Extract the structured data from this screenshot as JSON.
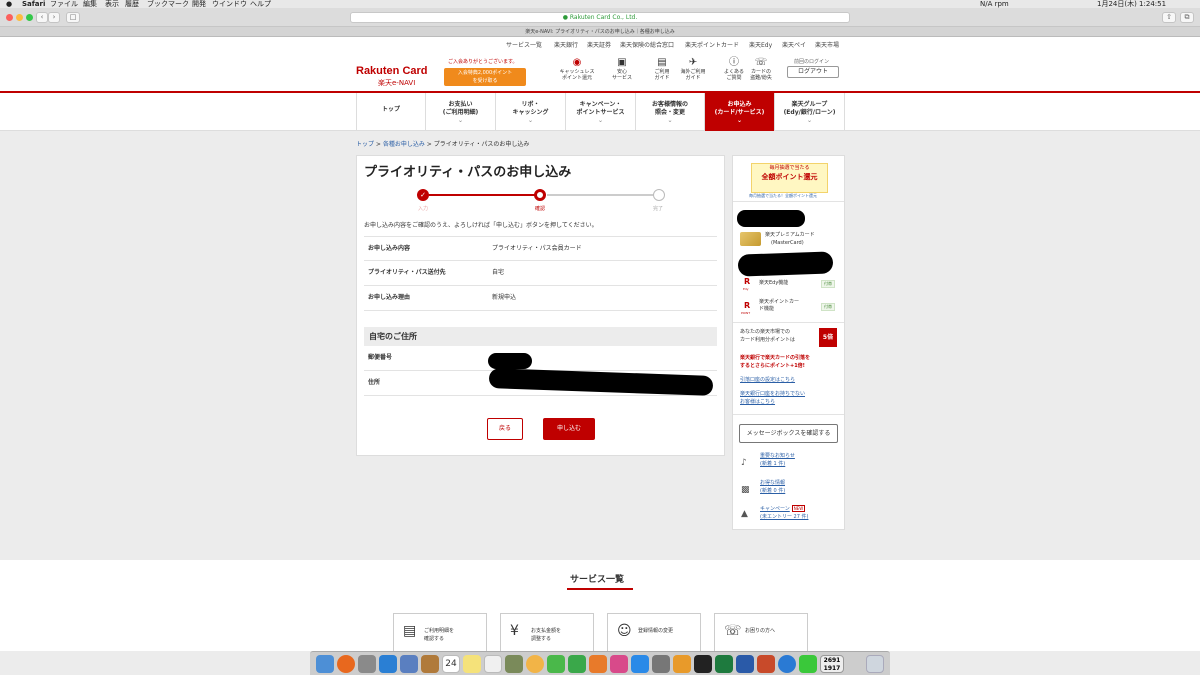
{
  "menubar": {
    "apple": "",
    "app": "Safari",
    "items": [
      "ファイル",
      "編集",
      "表示",
      "履歴",
      "ブックマーク",
      "開発",
      "ウインドウ",
      "ヘルプ"
    ],
    "status": "N/A rpm",
    "datetime": "1月24日(木)  1:24:51"
  },
  "browser": {
    "url": "Rakuten Card Co., Ltd.",
    "tab_title": "楽天e-NAVI: プライオリティ・パスのお申し込み｜各種お申し込み"
  },
  "util_nav": [
    "サービス一覧",
    "楽天銀行",
    "楽天証券",
    "楽天保険の総合窓口",
    "楽天ポイントカード",
    "楽天Edy",
    "楽天ペイ",
    "楽天市場"
  ],
  "header": {
    "logo_main": "Rakuten Card",
    "logo_sub": "楽天e-NAVI",
    "promo_text": "ご入会ありがとうございます。",
    "promo_button_line1": "入会特典2,000ポイント",
    "promo_button_line2": "を受け取る",
    "icons": [
      {
        "icon": "cashless-icon",
        "line1": "キャッシュレス",
        "line2": "ポイント還元"
      },
      {
        "icon": "lock-icon",
        "line1": "安心",
        "line2": "サービス"
      },
      {
        "icon": "book-icon",
        "line1": "ご利用",
        "line2": "ガイド"
      },
      {
        "icon": "plane-icon",
        "line1": "海外ご利用",
        "line2": "ガイド"
      },
      {
        "icon": "question-icon",
        "line1": "よくある",
        "line2": "ご質問"
      },
      {
        "icon": "phone-icon",
        "line1": "カードの",
        "line2": "盗難/紛失"
      }
    ],
    "last_login": "前回のログイン",
    "logout": "ログアウト"
  },
  "main_nav": [
    {
      "line1": "トップ",
      "line2": ""
    },
    {
      "line1": "お支払い",
      "line2": "(ご利用明細)"
    },
    {
      "line1": "リボ・",
      "line2": "キャッシング"
    },
    {
      "line1": "キャンペーン・",
      "line2": "ポイントサービス"
    },
    {
      "line1": "お客様情報の",
      "line2": "照会・変更"
    },
    {
      "line1": "お申込み",
      "line2": "(カード/サービス)"
    },
    {
      "line1": "楽天グループ",
      "line2": "(Edy/銀行/ローン)"
    }
  ],
  "breadcrumb": {
    "home": "トップ",
    "sep1": " > ",
    "parent": "各種お申し込み",
    "sep2": " > ",
    "current": "プライオリティ・パスのお申し込み"
  },
  "form": {
    "title": "プライオリティ・パスのお申し込み",
    "steps": [
      "入力",
      "確認",
      "完了"
    ],
    "current_step": 2,
    "instruction": "お申し込み内容をご確認のうえ、よろしければ「申し込む」ボタンを押してください。",
    "rows": [
      {
        "label": "お申し込み内容",
        "value": "プライオリティ・パス会員カード"
      },
      {
        "label": "プライオリティ・パス送付先",
        "value": "自宅"
      },
      {
        "label": "お申し込み理由",
        "value": "新規申込"
      }
    ],
    "address_section_title": "自宅のご住所",
    "address_rows": [
      {
        "label": "郵便番号",
        "value": ""
      },
      {
        "label": "住所",
        "value": ""
      }
    ],
    "back_button": "戻る",
    "apply_button": "申し込む"
  },
  "sidebar": {
    "banner_line1": "毎月抽選で当たる",
    "banner_line2": "全額ポイント還元",
    "banner_link": "毎月抽選で当たる！全額ポイント還元",
    "card_name": "楽天プレミアムカード",
    "card_brand": "(MasterCard)",
    "edy": "楽天Edy機能",
    "edy_badge": "付帯",
    "point_line1": "楽天ポイントカー",
    "point_line2": "ド機能",
    "point_badge": "付帯",
    "rate_line1": "あなたの楽天市場での",
    "rate_line2": "カード利用分ポイントは",
    "rate_badge": "5倍",
    "bank_line1": "楽天銀行で楽天カードの引落を",
    "bank_line2": "するとさらにポイント+1倍!",
    "bank_link": "引落口座の設定はこちら",
    "bank_link2_line1": "楽天銀行口座をお持ちでない",
    "bank_link2_line2": "お客様はこちら",
    "message_button": "メッセージボックスを確認する",
    "notices": [
      {
        "icon": "bell-icon",
        "title": "重要なお知らせ",
        "count": "(新着 1 件)"
      },
      {
        "icon": "gift-icon",
        "title": "お得な情報",
        "count": "(新着 0 件)"
      },
      {
        "icon": "megaphone-icon",
        "title": "キャンペーン",
        "count": "(未エントリー 27 件)",
        "badge": "NEW"
      }
    ]
  },
  "footer": {
    "title": "サービス一覧",
    "cards": [
      {
        "icon": "document-icon",
        "line1": "ご利用明細を",
        "line2": "確認する"
      },
      {
        "icon": "yen-icon",
        "line1": "お支払金額を",
        "line2": "調整する"
      },
      {
        "icon": "person-icon",
        "line1": "登録情報の変更",
        "line2": ""
      },
      {
        "icon": "phone-icon",
        "line1": "お困りの方へ",
        "line2": ""
      }
    ]
  },
  "dock": {
    "calendar_day": "24",
    "widget_top": "2691",
    "widget_bottom": "1917"
  },
  "colors": {
    "brand_red": "#bf0000",
    "promo_orange": "#f08a1c",
    "link_blue": "#2b5fa6"
  }
}
